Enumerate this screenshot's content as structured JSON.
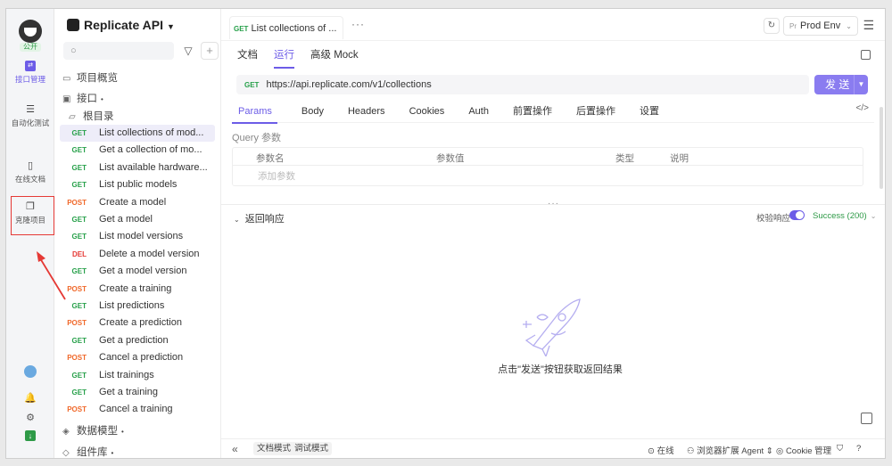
{
  "rail": {
    "badge": "公开",
    "items": [
      {
        "label": "接口管理",
        "icon": "api-icon"
      },
      {
        "label": "自动化测试",
        "icon": "automation-icon"
      },
      {
        "label": "在线文档",
        "icon": "book-icon"
      },
      {
        "label": "克隆项目",
        "icon": "clone-icon"
      }
    ]
  },
  "tree": {
    "project_name": "Replicate API",
    "search_placeholder": "",
    "overview": "项目概览",
    "interfaces": "接口",
    "root": "根目录",
    "apis": [
      {
        "method": "GET",
        "name": "List collections of mod..."
      },
      {
        "method": "GET",
        "name": "Get a collection of mo..."
      },
      {
        "method": "GET",
        "name": "List available hardware..."
      },
      {
        "method": "GET",
        "name": "List public models"
      },
      {
        "method": "POST",
        "name": "Create a model"
      },
      {
        "method": "GET",
        "name": "Get a model"
      },
      {
        "method": "GET",
        "name": "List model versions"
      },
      {
        "method": "DEL",
        "name": "Delete a model version"
      },
      {
        "method": "GET",
        "name": "Get a model version"
      },
      {
        "method": "POST",
        "name": "Create a training"
      },
      {
        "method": "GET",
        "name": "List predictions"
      },
      {
        "method": "POST",
        "name": "Create a prediction"
      },
      {
        "method": "GET",
        "name": "Get a prediction"
      },
      {
        "method": "POST",
        "name": "Cancel a prediction"
      },
      {
        "method": "GET",
        "name": "List trainings"
      },
      {
        "method": "GET",
        "name": "Get a training"
      },
      {
        "method": "POST",
        "name": "Cancel a training"
      }
    ],
    "data_models": "数据模型",
    "components": "组件库"
  },
  "main": {
    "tab": {
      "method": "GET",
      "title": "List collections of ..."
    },
    "more": "···",
    "env": "Prod Env",
    "env_prefix": "Pr",
    "modes": [
      "文档",
      "运行",
      "高级 Mock"
    ],
    "url_method": "GET",
    "url": "https://api.replicate.com/v1/collections",
    "send": "发 送",
    "param_tabs": [
      "Params",
      "Body",
      "Headers",
      "Cookies",
      "Auth",
      "前置操作",
      "后置操作",
      "设置"
    ],
    "code_icon": "</>",
    "query_label": "Query 参数",
    "table_headers": [
      "参数名",
      "参数值",
      "类型",
      "说明"
    ],
    "add_param": "添加参数",
    "response_title": "返回响应",
    "verify_label": "校验响应",
    "status": "Success (200)",
    "empty_text": "点击\"发送\"按钮获取返回结果",
    "grip": "···"
  },
  "footer": {
    "mode_doc": "文档模式",
    "mode_debug": "调试模式",
    "online": "在线",
    "agent": "浏览器扩展 Agent",
    "cookie": "Cookie 管理"
  }
}
